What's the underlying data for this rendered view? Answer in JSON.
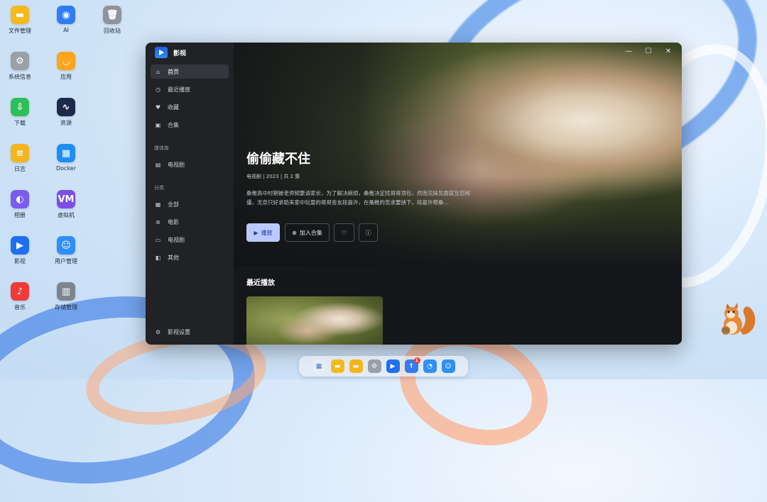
{
  "desktop": {
    "icons": [
      {
        "label": "文件管理",
        "icon": "folder-icon",
        "color": "#f6b91c"
      },
      {
        "label": "AI",
        "icon": "robot-icon",
        "color": "#2f7df0"
      },
      {
        "label": "回收站",
        "icon": "trash-icon",
        "color": "#8e949c"
      },
      {
        "label": "系统信息",
        "icon": "gear-icon",
        "color": "#9aa0a8"
      },
      {
        "label": "应用",
        "icon": "store-icon",
        "color": "#ffa41b"
      },
      {
        "label": "下载",
        "icon": "download-icon",
        "color": "#2fbf5a"
      },
      {
        "label": "资源",
        "icon": "monitor-icon",
        "color": "#1c2a4a"
      },
      {
        "label": "日志",
        "icon": "log-icon",
        "color": "#f5b51c"
      },
      {
        "label": "Docker",
        "icon": "docker-icon",
        "color": "#1d8ef2"
      },
      {
        "label": "相册",
        "icon": "photo-icon",
        "color": "#7a5cf0"
      },
      {
        "label": "虚拟机",
        "icon": "vm-icon",
        "color": "#7b4ee6"
      },
      {
        "label": "影视",
        "icon": "video-icon",
        "color": "#1f6ff0"
      },
      {
        "label": "用户管理",
        "icon": "users-icon",
        "color": "#2f8ff5"
      },
      {
        "label": "音乐",
        "icon": "music-icon",
        "color": "#f03a3a"
      },
      {
        "label": "存储管理",
        "icon": "storage-icon",
        "color": "#7c8490"
      }
    ]
  },
  "app": {
    "name": "影视",
    "nav": [
      {
        "label": "首页",
        "icon": "home-icon",
        "active": true
      },
      {
        "label": "最近播放",
        "icon": "clock-icon"
      },
      {
        "label": "收藏",
        "icon": "heart-icon"
      },
      {
        "label": "合集",
        "icon": "collection-icon"
      }
    ],
    "library_title": "媒体库",
    "library": [
      {
        "label": "电视剧",
        "icon": "film-icon"
      }
    ],
    "category_title": "分类",
    "categories": [
      {
        "label": "全部",
        "icon": "grid-icon"
      },
      {
        "label": "电影",
        "icon": "reel-icon"
      },
      {
        "label": "电视剧",
        "icon": "tv-icon"
      },
      {
        "label": "其他",
        "icon": "other-icon"
      }
    ],
    "settings_label": "影视设置"
  },
  "hero": {
    "title": "偷偷藏不住",
    "meta": "电视剧   |   2023   |   共 2 集",
    "description": "桑稚高中时期被老师频繁请家长，为了解决麻烦，桑稚决定找哥哥顶包，然而兄妹见面就互怼闹僵，无奈只好求助来家中玩耍的哥哥舍友段嘉许，在桑稚的苦求要挟下，段嘉许帮桑…",
    "play_label": "播放",
    "add_label": "加入合集"
  },
  "recent": {
    "title": "最近播放"
  },
  "window_controls": {
    "minimize": "—",
    "maximize": "☐",
    "close": "✕"
  },
  "dock": {
    "items": [
      {
        "icon": "launcher-icon",
        "color": "#e9edf3"
      },
      {
        "icon": "folder-icon",
        "color": "#f6b91c"
      },
      {
        "icon": "folder-icon",
        "color": "#f5b51c"
      },
      {
        "icon": "gear-icon",
        "color": "#9aa0a8"
      },
      {
        "icon": "video-icon",
        "color": "#1f6ff0"
      },
      {
        "icon": "update-icon",
        "color": "#2f7df0",
        "badge": "1"
      },
      {
        "icon": "notification-icon",
        "color": "#2f8ff5"
      },
      {
        "icon": "user-icon",
        "color": "#2f8ff5"
      }
    ]
  }
}
